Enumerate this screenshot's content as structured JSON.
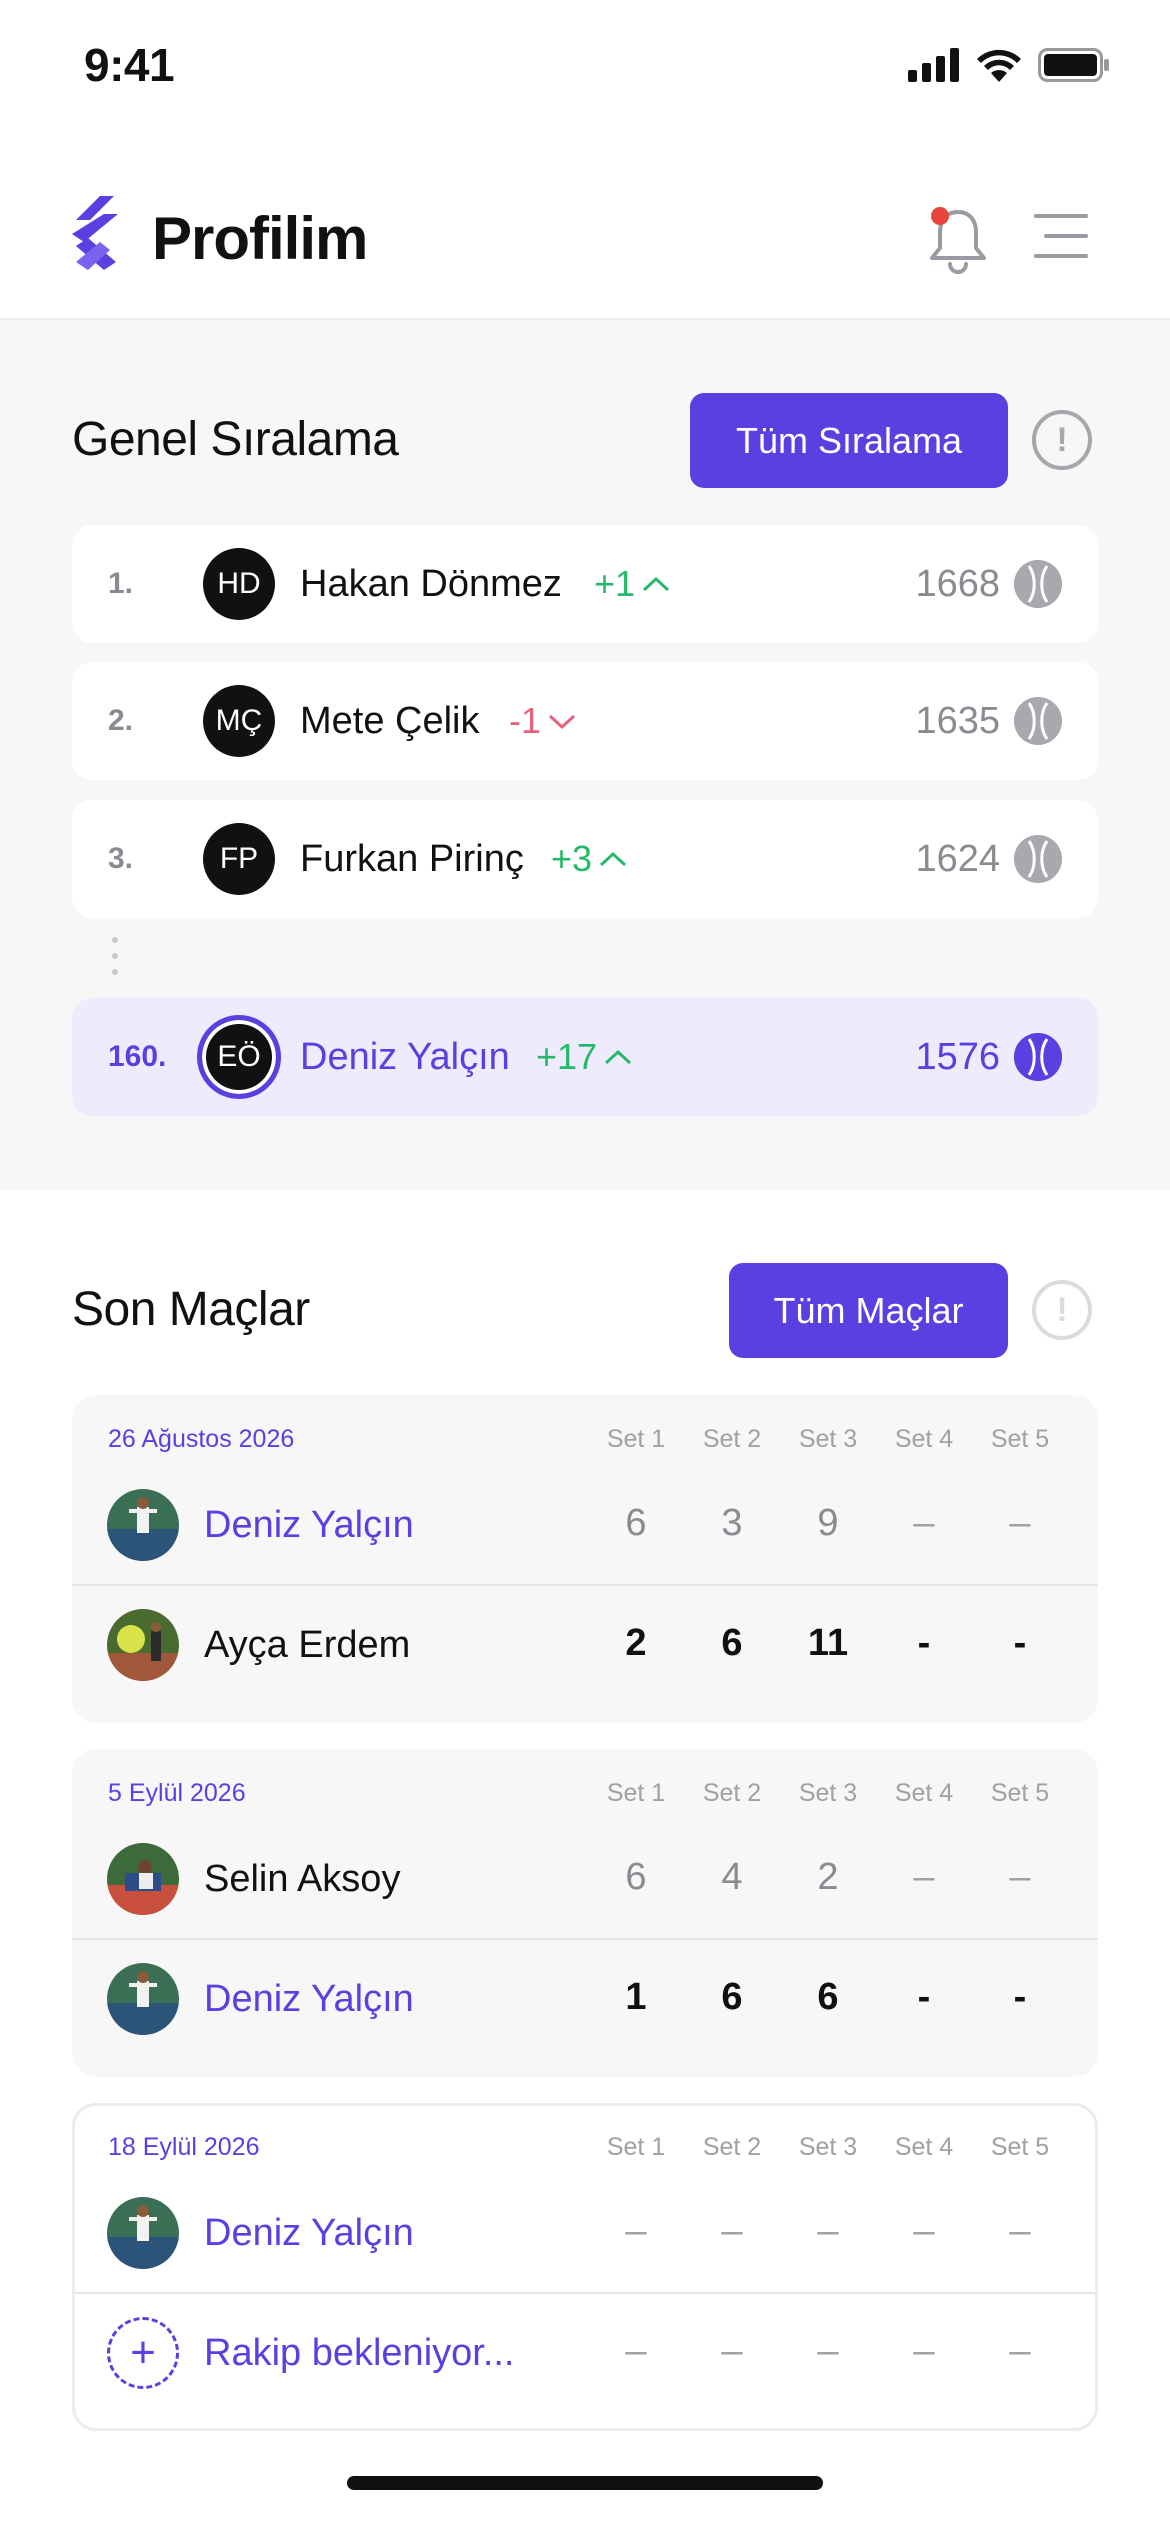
{
  "status_bar": {
    "time": "9:41"
  },
  "header": {
    "title": "Profilim"
  },
  "ranking": {
    "title": "Genel Sıralama",
    "all_button": "Tüm Sıralama",
    "info": "!",
    "rows": [
      {
        "position": "1.",
        "initials": "HD",
        "name": "Hakan Dönmez",
        "change": "+1",
        "trend": "up",
        "points": "1668"
      },
      {
        "position": "2.",
        "initials": "MÇ",
        "name": "Mete Çelik",
        "change": "-1",
        "trend": "down",
        "points": "1635"
      },
      {
        "position": "3.",
        "initials": "FP",
        "name": "Furkan Pirinç",
        "change": "+3",
        "trend": "up",
        "points": "1624"
      },
      {
        "position": "160.",
        "initials": "EÖ",
        "name": "Deniz Yalçın",
        "change": "+17",
        "trend": "up",
        "points": "1576"
      }
    ]
  },
  "matches": {
    "title": "Son Maçlar",
    "all_button": "Tüm Maçlar",
    "info": "!",
    "set_labels": [
      "Set 1",
      "Set 2",
      "Set 3",
      "Set 4",
      "Set 5"
    ],
    "cards": [
      {
        "date": "26 Ağustos 2026",
        "players": [
          {
            "name": "Deniz Yalçın",
            "is_me": true,
            "scores": [
              "6",
              "3",
              "9",
              "–",
              "–"
            ],
            "won": false
          },
          {
            "name": "Ayça Erdem",
            "is_me": false,
            "scores": [
              "2",
              "6",
              "11",
              "-",
              "-"
            ],
            "won": true
          }
        ]
      },
      {
        "date": "5 Eylül 2026",
        "players": [
          {
            "name": "Selin Aksoy",
            "is_me": false,
            "scores": [
              "6",
              "4",
              "2",
              "–",
              "–"
            ],
            "won": false
          },
          {
            "name": "Deniz Yalçın",
            "is_me": true,
            "scores": [
              "1",
              "6",
              "6",
              "-",
              "-"
            ],
            "won": true
          }
        ]
      },
      {
        "date": "18 Eylül 2026",
        "players": [
          {
            "name": "Deniz Yalçın",
            "is_me": true,
            "scores": [
              "–",
              "–",
              "–",
              "–",
              "–"
            ],
            "won": false
          },
          {
            "name": "Rakip bekleniyor...",
            "is_me": true,
            "pending": true,
            "scores": [
              "–",
              "–",
              "–",
              "–",
              "–"
            ],
            "won": false
          }
        ]
      }
    ]
  },
  "colors": {
    "brand": "#5b3fe0",
    "up": "#27b96b",
    "down": "#e8617c",
    "notification": "#e8453c"
  }
}
